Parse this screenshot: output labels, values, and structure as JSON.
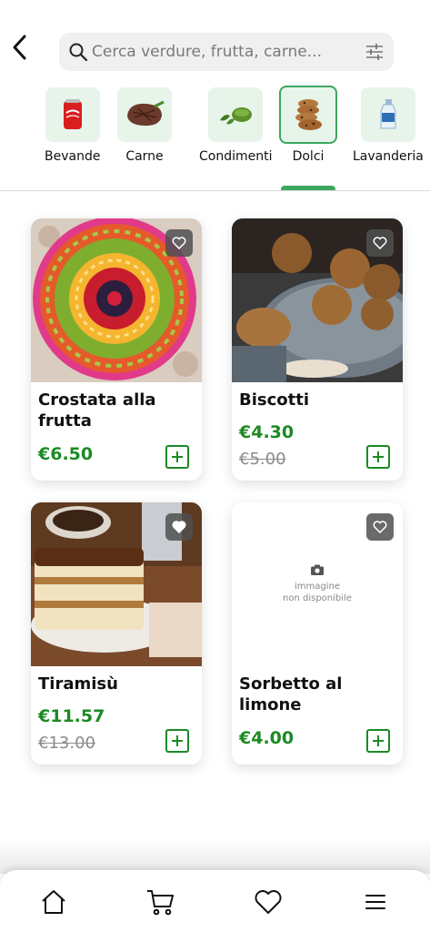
{
  "search": {
    "placeholder": "Cerca verdure, frutta, carne..."
  },
  "categories": [
    {
      "label": "Bevande",
      "icon": "soda-can-icon",
      "active": false
    },
    {
      "label": "Carne",
      "icon": "steak-icon",
      "active": false
    },
    {
      "label": "Condimenti",
      "icon": "pesto-icon",
      "active": false
    },
    {
      "label": "Dolci",
      "icon": "cookies-icon",
      "active": true
    },
    {
      "label": "Lavanderia",
      "icon": "detergent-bottle-icon",
      "active": false
    }
  ],
  "products": [
    {
      "name": "Crostata alla frutta",
      "price": "€6.50",
      "old_price": "",
      "image": "fruit-tart-photo"
    },
    {
      "name": "Biscotti",
      "price": "€4.30",
      "old_price": "€5.00",
      "image": "biscotti-photo"
    },
    {
      "name": "Tiramisù",
      "price": "€11.57",
      "old_price": "€13.00",
      "image": "tiramisu-photo"
    },
    {
      "name": "Sorbetto al limone",
      "price": "€4.00",
      "old_price": "",
      "image": "none"
    }
  ],
  "no_image_text": {
    "line1": "immagine",
    "line2": "non disponibile"
  },
  "nav": [
    "home-icon",
    "cart-icon",
    "heart-icon",
    "menu-icon"
  ],
  "colors": {
    "accent_green": "#1b8a24",
    "category_bg": "#e6f4ea",
    "active_border": "#3ca760"
  }
}
